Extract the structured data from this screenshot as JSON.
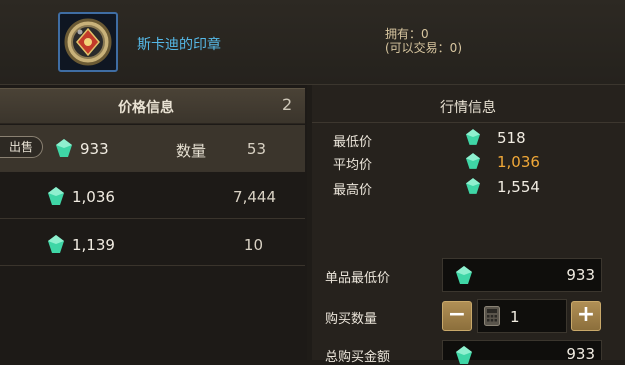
{
  "item": {
    "name": "斯卡迪的印章",
    "owned_line": "拥有：0",
    "tradeable_line": "(可以交易：0)"
  },
  "listings": {
    "header_title": "价格信息",
    "header_count": "2",
    "sell_label": "出售",
    "qty_label": "数量",
    "rows": [
      {
        "price": "933",
        "quantity": "53"
      },
      {
        "price": "1,036",
        "quantity": "7,444"
      },
      {
        "price": "1,139",
        "quantity": "10"
      }
    ]
  },
  "market": {
    "title": "行情信息",
    "rows": [
      {
        "label": "最低价",
        "value": "518"
      },
      {
        "label": "平均价",
        "value": "1,036"
      },
      {
        "label": "最高价",
        "value": "1,554"
      }
    ]
  },
  "buy_form": {
    "unit_min_label": "单品最低价",
    "unit_min_value": "933",
    "qty_label": "购买数量",
    "qty_value": "1",
    "minus_label": "−",
    "plus_label": "+",
    "total_label": "总购买金额",
    "total_value": "933"
  },
  "colors": {
    "item_name": "#56b8e6",
    "average_price": "#f0a838",
    "gem": "#3fd6a6"
  },
  "icons": {
    "currency": "green-gem-icon",
    "item": "seal-emblem-icon",
    "calculator": "calculator-icon"
  }
}
